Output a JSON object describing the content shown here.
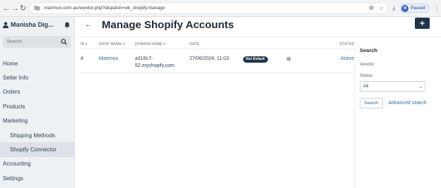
{
  "browser": {
    "url": "martmox.com.au/vendor.php?dispatch=wk_shopify.manage",
    "profile_initial": "M",
    "profile_status": "Paused"
  },
  "sidebar": {
    "vendor_name": "Manisha Dig...",
    "search_placeholder": "Search",
    "items": [
      {
        "label": "Home"
      },
      {
        "label": "Seller Info"
      },
      {
        "label": "Orders"
      },
      {
        "label": "Products"
      },
      {
        "label": "Marketing"
      },
      {
        "label": "Shipping Methods"
      },
      {
        "label": "Shopify Connector"
      },
      {
        "label": "Accounting"
      },
      {
        "label": "Settings"
      }
    ]
  },
  "page": {
    "title": "Manage Shopify Accounts",
    "add_label": "+"
  },
  "table": {
    "headers": {
      "id": "ID",
      "shop_name": "SHOP NAME",
      "domain_name": "DOMAIN NAME",
      "date": "DATE",
      "status": "STATUS"
    },
    "rows": [
      {
        "id": "4",
        "shop_name": "Martmox",
        "domain_line1": "a319c7-",
        "domain_line2": "52.myshopify.com",
        "date": "27/06/2024, 11:03",
        "badge": "Not Default",
        "status": "Active"
      }
    ]
  },
  "search_panel": {
    "title": "Search",
    "vendor_label": "Vendor",
    "status_label": "Status",
    "status_value": "All",
    "search_button": "Search",
    "advanced_link": "Advanced search"
  }
}
